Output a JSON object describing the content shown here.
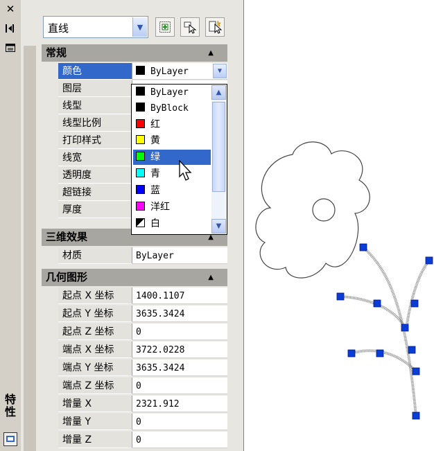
{
  "palette": {
    "vertical_title": "特性",
    "icons": [
      "close-icon",
      "autohide-icon",
      "properties-menu-icon",
      "palette-settings-icon"
    ]
  },
  "toolbar": {
    "object_type": "直线",
    "buttons": [
      "toggle-pickadd-icon",
      "select-objects-icon",
      "quick-select-icon"
    ]
  },
  "categories": {
    "general": "常规",
    "3d": "三维效果",
    "geometry": "几何图形"
  },
  "general_rows": [
    {
      "name": "颜色",
      "value": "ByLayer",
      "swatch": "#000000"
    },
    {
      "name": "图层",
      "value": ""
    },
    {
      "name": "线型",
      "value": ""
    },
    {
      "name": "线型比例",
      "value": ""
    },
    {
      "name": "打印样式",
      "value": ""
    },
    {
      "name": "线宽",
      "value": ""
    },
    {
      "name": "透明度",
      "value": ""
    },
    {
      "name": "超链接",
      "value": ""
    },
    {
      "name": "厚度",
      "value": ""
    }
  ],
  "effects_rows": [
    {
      "name": "材质",
      "value": "ByLayer"
    }
  ],
  "geometry_rows": [
    {
      "name": "起点 X 坐标",
      "value": "1400.1107"
    },
    {
      "name": "起点 Y 坐标",
      "value": "3635.3424"
    },
    {
      "name": "起点 Z 坐标",
      "value": "0"
    },
    {
      "name": "端点 X 坐标",
      "value": "3722.0228"
    },
    {
      "name": "端点 Y 坐标",
      "value": "3635.3424"
    },
    {
      "name": "端点 Z 坐标",
      "value": "0"
    },
    {
      "name": "增量 X",
      "value": "2321.912"
    },
    {
      "name": "增量 Y",
      "value": "0"
    },
    {
      "name": "增量 Z",
      "value": "0"
    }
  ],
  "color_dropdown": {
    "highlighted": "绿",
    "options": [
      {
        "label": "ByLayer",
        "color": "#000000"
      },
      {
        "label": "ByBlock",
        "color": "#000000"
      },
      {
        "label": "红",
        "color": "#ff0000"
      },
      {
        "label": "黄",
        "color": "#ffff00"
      },
      {
        "label": "绿",
        "color": "#00ff00"
      },
      {
        "label": "青",
        "color": "#00ffff"
      },
      {
        "label": "蓝",
        "color": "#0000ff"
      },
      {
        "label": "洋红",
        "color": "#ff00ff"
      },
      {
        "label": "白",
        "color": "#ffffff"
      }
    ]
  },
  "colors": {
    "selection": "#3168c9",
    "grip": "#0a3cd6"
  }
}
